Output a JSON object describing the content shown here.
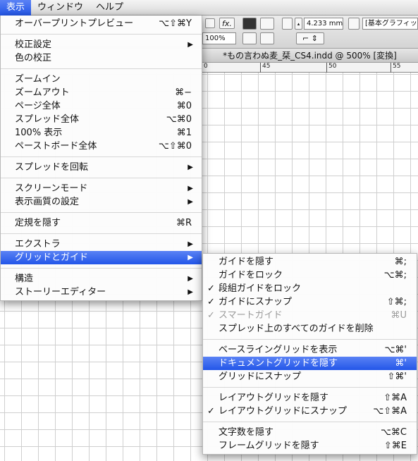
{
  "menubar": {
    "items": [
      {
        "label": "表示",
        "active": true
      },
      {
        "label": "ウィンドウ",
        "active": false
      },
      {
        "label": "ヘルプ",
        "active": false
      }
    ]
  },
  "toolbar": {
    "measure_value": "4.233 mm",
    "zoom_value": "100%",
    "style_field": "[基本グラフィック",
    "fx_label": "fx."
  },
  "document": {
    "title": "*もの言わぬ麦_栞_CS4.indd @ 500% [変換]",
    "ruler_labels": [
      "0",
      "45",
      "50",
      "55"
    ]
  },
  "main_menu": {
    "items": [
      {
        "label": "オーバープリントプレビュー",
        "shortcut": "⌥⇧⌘Y"
      },
      {
        "sep": true
      },
      {
        "label": "校正設定",
        "submenu": true
      },
      {
        "label": "色の校正"
      },
      {
        "sep": true
      },
      {
        "label": "ズームイン"
      },
      {
        "label": "ズームアウト",
        "shortcut": "⌘−"
      },
      {
        "label": "ページ全体",
        "shortcut": "⌘0"
      },
      {
        "label": "スプレッド全体",
        "shortcut": "⌥⌘0"
      },
      {
        "label": "100% 表示",
        "shortcut": "⌘1"
      },
      {
        "label": "ペーストボード全体",
        "shortcut": "⌥⇧⌘0"
      },
      {
        "sep": true
      },
      {
        "label": "スプレッドを回転",
        "submenu": true
      },
      {
        "sep": true
      },
      {
        "label": "スクリーンモード",
        "submenu": true
      },
      {
        "label": "表示画質の設定",
        "submenu": true
      },
      {
        "sep": true
      },
      {
        "label": "定規を隠す",
        "shortcut": "⌘R"
      },
      {
        "sep": true
      },
      {
        "label": "エクストラ",
        "submenu": true
      },
      {
        "label": "グリッドとガイド",
        "submenu": true,
        "highlighted": true
      },
      {
        "sep": true
      },
      {
        "label": "構造",
        "submenu": true
      },
      {
        "label": "ストーリーエディター",
        "submenu": true
      }
    ]
  },
  "sub_menu": {
    "items": [
      {
        "label": "ガイドを隠す",
        "shortcut": "⌘;"
      },
      {
        "label": "ガイドをロック",
        "shortcut": "⌥⌘;"
      },
      {
        "label": "段組ガイドをロック",
        "checked": true
      },
      {
        "label": "ガイドにスナップ",
        "shortcut": "⇧⌘;",
        "checked": true
      },
      {
        "label": "スマートガイド",
        "shortcut": "⌘U",
        "checked": true,
        "disabled": true
      },
      {
        "label": "スプレッド上のすべてのガイドを削除"
      },
      {
        "sep": true
      },
      {
        "label": "ベースライングリッドを表示",
        "shortcut": "⌥⌘'"
      },
      {
        "label": "ドキュメントグリッドを隠す",
        "shortcut": "⌘'",
        "highlighted": true
      },
      {
        "label": "グリッドにスナップ",
        "shortcut": "⇧⌘'"
      },
      {
        "sep": true
      },
      {
        "label": "レイアウトグリッドを隠す",
        "shortcut": "⇧⌘A"
      },
      {
        "label": "レイアウトグリッドにスナップ",
        "shortcut": "⌥⇧⌘A",
        "checked": true
      },
      {
        "sep": true
      },
      {
        "label": "文字数を隠す",
        "shortcut": "⌥⌘C"
      },
      {
        "label": "フレームグリッドを隠す",
        "shortcut": "⇧⌘E"
      }
    ]
  },
  "icons": {
    "checkmark": "✓",
    "submenu_arrow": "▶"
  },
  "colors": {
    "highlight": "#2f62ec",
    "disabled_text": "#9a9a9a"
  }
}
